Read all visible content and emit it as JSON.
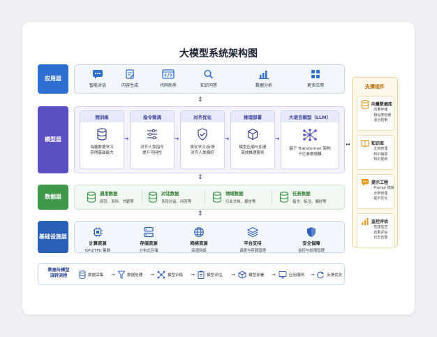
{
  "title": "大模型系统架构图",
  "layers": {
    "app": "应用层",
    "model": "模型层",
    "data": "数据层",
    "infra": "基础设施层"
  },
  "app_items": [
    {
      "label": "智能对话",
      "icon": "chat-icon"
    },
    {
      "label": "内容生成",
      "icon": "edit-document-icon"
    },
    {
      "label": "代码助手",
      "icon": "code-icon"
    },
    {
      "label": "知识问答",
      "icon": "search-icon"
    },
    {
      "label": "数据分析",
      "icon": "bar-chart-icon"
    },
    {
      "label": "更多应用",
      "icon": "grid-icon"
    }
  ],
  "stages": [
    {
      "title": "预训练",
      "desc1": "海量数据学习",
      "desc2": "获得基础能力",
      "icon": "database-icon"
    },
    {
      "title": "指令微调",
      "desc1": "对齐人类指令",
      "desc2": "提升可用性",
      "icon": "sliders-icon"
    },
    {
      "title": "对齐优化",
      "desc1": "强化学习/反馈",
      "desc2": "对齐人类偏好",
      "icon": "shield-check-icon"
    },
    {
      "title": "推理部署",
      "desc1": "模型压缩与加速",
      "desc2": "高效推理服务",
      "icon": "cube-icon"
    }
  ],
  "llm": {
    "title": "大语言模型（LLM）",
    "desc1": "基于 Transformer 架构",
    "desc2": "千亿参数规模",
    "icon": "neural-network-icon"
  },
  "data_items": [
    {
      "title": "通用数据",
      "desc": "网页、百科、书籍等"
    },
    {
      "title": "对话数据",
      "desc": "多轮对话、问答等"
    },
    {
      "title": "领域数据",
      "desc": "行业文档、报告等"
    },
    {
      "title": "任务数据",
      "desc": "指令、标注、偏好等"
    }
  ],
  "infra_items": [
    {
      "title": "计算资源",
      "desc": "GPU/TPU 集群",
      "icon": "chip-icon"
    },
    {
      "title": "存储资源",
      "desc": "分布式存储",
      "icon": "server-icon"
    },
    {
      "title": "网络资源",
      "desc": "高速网络",
      "icon": "globe-icon"
    },
    {
      "title": "平台支持",
      "desc": "调度与容器管理",
      "icon": "platform-icon"
    },
    {
      "title": "安全保障",
      "desc": "监控与权限管理",
      "icon": "shield-icon"
    }
  ],
  "flow": {
    "label1": "数据与模型",
    "label2": "流转流程",
    "steps": [
      "数据采集",
      "数据处理",
      "模型训练",
      "模型评估",
      "模型部署",
      "应用服务",
      "反馈优化"
    ]
  },
  "support": {
    "title": "支撑组件",
    "groups": [
      {
        "title": "向量数据库",
        "items": [
          "向量存储",
          "相似度检索",
          "混合检索"
        ],
        "icon": "database-icon"
      },
      {
        "title": "知识库",
        "items": [
          "文档管理",
          "知识抽取",
          "知识更新"
        ],
        "icon": "book-icon"
      },
      {
        "title": "提示工程",
        "items": [
          "Prompt 模板",
          "示例管理",
          "提示优化"
        ],
        "icon": "message-icon"
      },
      {
        "title": "监控评估",
        "items": [
          "性能监控",
          "效果评估",
          "日志告警"
        ],
        "icon": "chart-icon"
      }
    ]
  },
  "colors": {
    "app": "#2f6fd1",
    "model": "#5b4fc4",
    "data": "#3e9a4a",
    "infra": "#2c5fb8",
    "support": "#e59a1c"
  }
}
